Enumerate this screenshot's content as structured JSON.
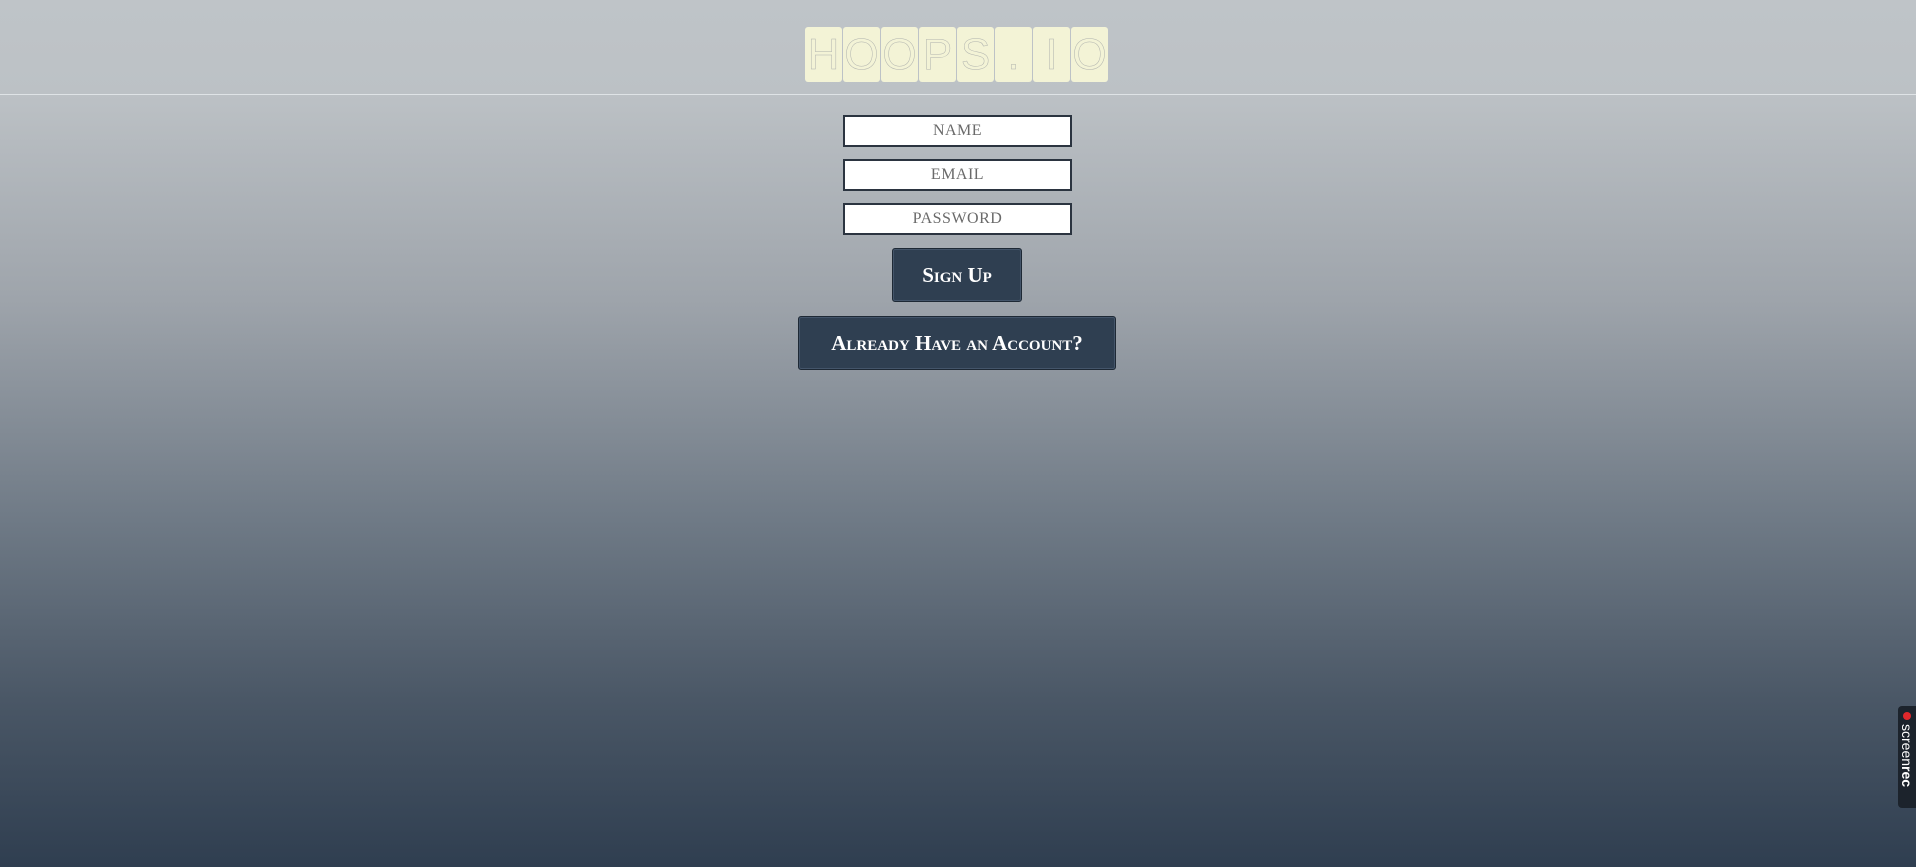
{
  "logo": {
    "letters": [
      "H",
      "O",
      "O",
      "P",
      "S",
      ".",
      "I",
      "O"
    ]
  },
  "form": {
    "name_placeholder": "NAME",
    "email_placeholder": "EMAIL",
    "password_placeholder": "PASSWORD",
    "signup_label": "Sign Up",
    "login_label": "Already Have an Account?"
  },
  "recorder_badge": {
    "text_light": "screen",
    "text_bold": "rec",
    "dot_color": "#e0282c"
  },
  "colors": {
    "button_bg": "#2f3f51",
    "tile_bg": "#f3f3d6"
  }
}
